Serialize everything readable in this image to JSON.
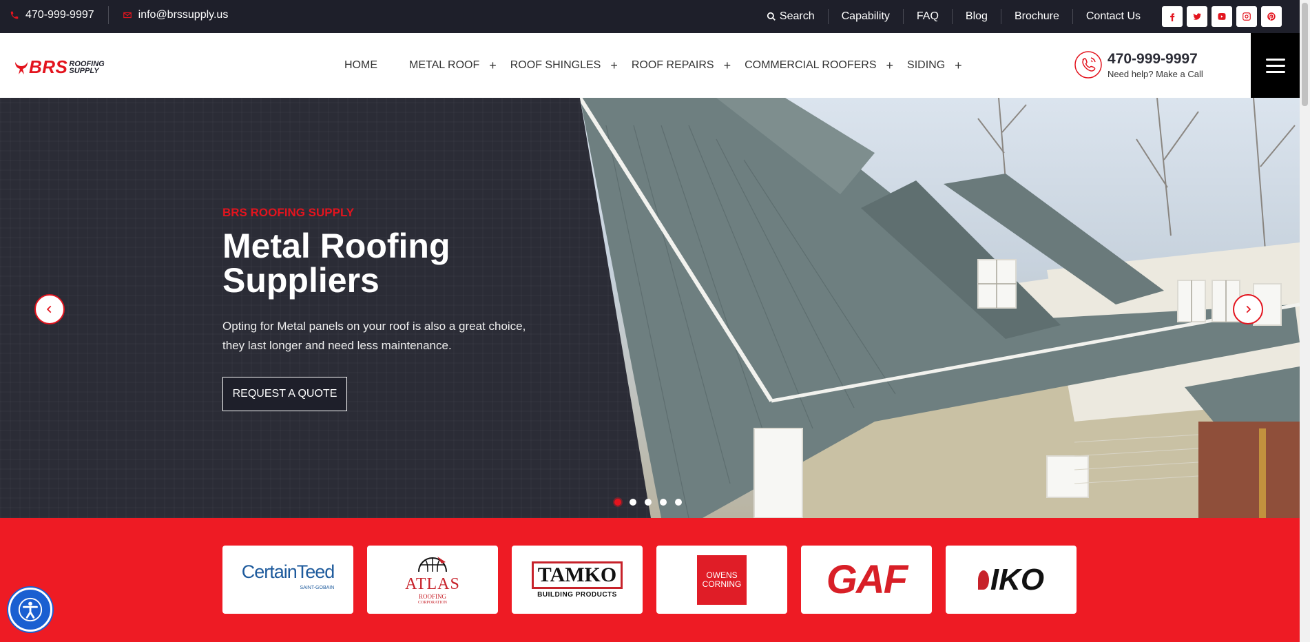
{
  "topbar": {
    "phone": "470-999-9997",
    "email": "info@brssupply.us",
    "links": [
      "Search",
      "Capability",
      "FAQ",
      "Blog",
      "Brochure",
      "Contact Us"
    ],
    "socials": [
      "facebook-icon",
      "twitter-icon",
      "youtube-icon",
      "instagram-icon",
      "pinterest-icon"
    ]
  },
  "header": {
    "logo_main": "BRS",
    "logo_sub1": "ROOFING",
    "logo_sub2": "SUPPLY",
    "nav": [
      {
        "label": "HOME",
        "has_submenu": false
      },
      {
        "label": "METAL ROOF",
        "has_submenu": true
      },
      {
        "label": "ROOF SHINGLES",
        "has_submenu": true
      },
      {
        "label": "ROOF REPAIRS",
        "has_submenu": true
      },
      {
        "label": "COMMERCIAL ROOFERS",
        "has_submenu": true
      },
      {
        "label": "SIDING",
        "has_submenu": true
      }
    ],
    "phone": "470-999-9997",
    "phone_caption": "Need help? Make a Call"
  },
  "hero": {
    "eyebrow": "BRS ROOFING SUPPLY",
    "title": "Metal Roofing Suppliers",
    "description": "Opting for Metal panels on your roof is also a great choice, they last longer and need less maintenance.",
    "cta": "REQUEST A QUOTE",
    "slides_total": 5,
    "active_slide": 1
  },
  "brands": {
    "certainteed": "CertainTeed",
    "certainteed_sub": "SAINT-GOBAIN",
    "atlas": "ATLAS",
    "atlas_sub1": "ROOFING",
    "atlas_sub2": "CORPORATION",
    "tamko": "TAMKO",
    "tamko_sub": "BUILDING PRODUCTS",
    "owens1": "OWENS",
    "owens2": "CORNING",
    "gaf": "GAF",
    "iko": "IKO"
  },
  "colors": {
    "accent": "#e3141e",
    "topbar_bg": "#1e1f2a",
    "hero_bg": "#2b2c36",
    "brand_strip": "#ee1b24"
  }
}
